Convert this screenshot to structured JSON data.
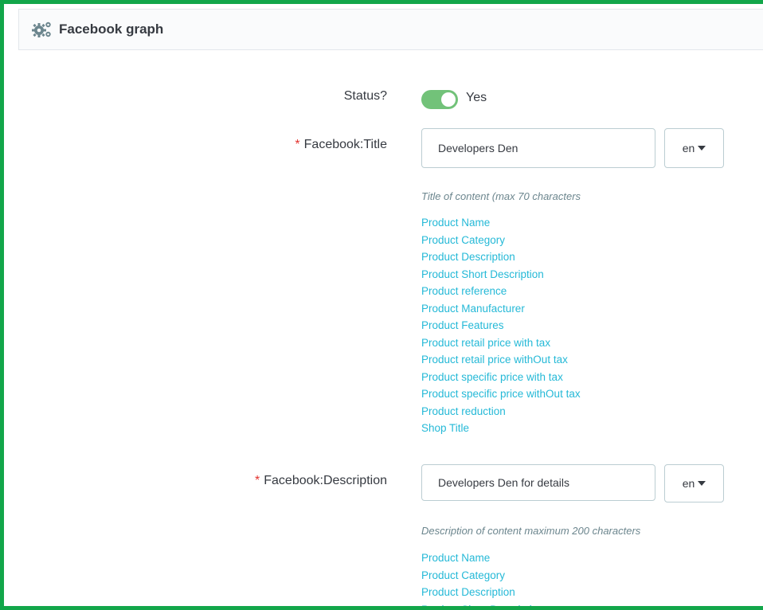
{
  "panel": {
    "title": "Facebook graph"
  },
  "status": {
    "label": "Status?",
    "value_label": "Yes"
  },
  "title_field": {
    "label": "Facebook:Title",
    "value": "Developers Den",
    "lang": "en",
    "help": "Title of content (max 70 characters",
    "links": [
      "Product Name",
      "Product Category",
      "Product Description",
      "Product Short Description",
      "Product reference",
      "Product Manufacturer",
      "Product Features",
      "Product retail price with tax",
      "Product retail price withOut tax",
      "Product specific price with tax",
      "Product specific price withOut tax",
      "Product reduction",
      "Shop Title"
    ]
  },
  "description_field": {
    "label": "Facebook:Description",
    "value": "Developers Den for details",
    "lang": "en",
    "help": "Description of content maximum 200 characters",
    "links": [
      "Product Name",
      "Product Category",
      "Product Description",
      "Product Short Description"
    ]
  },
  "required_mark": "*",
  "colors": {
    "accent_green": "#72c279",
    "frame_green": "#12a64a",
    "link_blue": "#25b9d7",
    "required_red": "#e3342f"
  }
}
